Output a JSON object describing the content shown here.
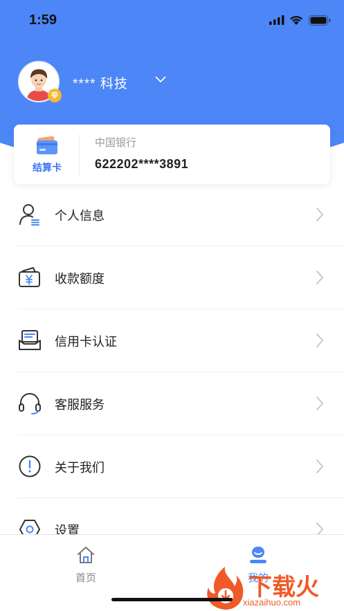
{
  "status_bar": {
    "time": "1:59"
  },
  "profile": {
    "company_name": "**** 科技"
  },
  "card": {
    "type_label": "结算卡",
    "bank_name": "中国银行",
    "card_number": "622202****3891"
  },
  "menu": {
    "items": [
      {
        "label": "个人信息",
        "icon": "person-info-icon"
      },
      {
        "label": "收款额度",
        "icon": "wallet-yuan-icon"
      },
      {
        "label": "信用卡认证",
        "icon": "card-verify-icon"
      },
      {
        "label": "客服服务",
        "icon": "headset-icon"
      },
      {
        "label": "关于我们",
        "icon": "info-circle-icon"
      },
      {
        "label": "设置",
        "icon": "settings-icon"
      }
    ]
  },
  "tabbar": {
    "tabs": [
      {
        "label": "首页",
        "icon": "home-icon"
      },
      {
        "label": "我的",
        "icon": "user-icon"
      }
    ]
  },
  "watermark": {
    "brand": "下载火",
    "url": "xiazaihuo.com"
  },
  "colors": {
    "primary": "#4d86f6",
    "watermark": "#f05a28"
  }
}
